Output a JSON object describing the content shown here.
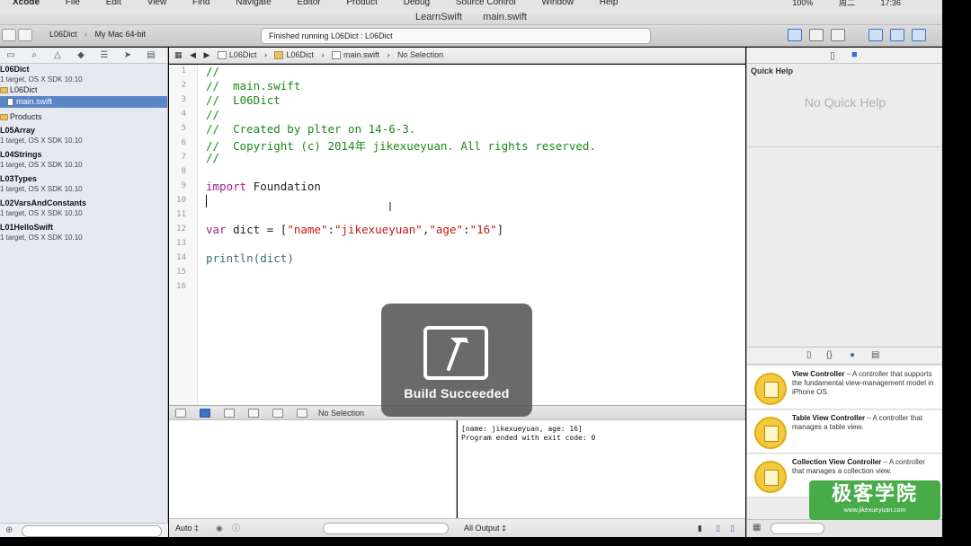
{
  "menubar": {
    "app": "Xcode",
    "items": [
      "File",
      "Edit",
      "View",
      "Find",
      "Navigate",
      "Editor",
      "Product",
      "Debug",
      "Source Control",
      "Window",
      "Help"
    ],
    "battery": "100%",
    "day": "周二",
    "clock": "17:36"
  },
  "titlebar": {
    "project": "LearnSwift",
    "file": "main.swift"
  },
  "toolbar": {
    "scheme": "L06Dict",
    "destination": "My Mac 64-bit",
    "activity": "Finished running L06Dict : L06Dict"
  },
  "navigator": {
    "projects": [
      {
        "name": "L06Dict",
        "sub": "1 target, OS X SDK 10.10"
      },
      {
        "name": "L05Array",
        "sub": "1 target, OS X SDK 10.10"
      },
      {
        "name": "L04Strings",
        "sub": "1 target, OS X SDK 10.10"
      },
      {
        "name": "L03Types",
        "sub": "1 target, OS X SDK 10.10"
      },
      {
        "name": "L02VarsAndConstants",
        "sub": "1 target, OS X SDK 10.10"
      },
      {
        "name": "L01HelloSwift",
        "sub": "1 target, OS X SDK 10.10"
      }
    ],
    "group": "L06Dict",
    "selected_file": "main.swift",
    "products": "Products"
  },
  "jumpbar": {
    "project": "L06Dict",
    "group": "L06Dict",
    "file": "main.swift",
    "selection": "No Selection"
  },
  "editor": {
    "line_numbers": [
      "1",
      "2",
      "3",
      "4",
      "5",
      "6",
      "7",
      "8",
      "9",
      "10",
      "11",
      "12",
      "13",
      "14",
      "15",
      "16"
    ],
    "lines": {
      "l1": "//",
      "l2": "//  main.swift",
      "l3": "//  L06Dict",
      "l4": "//",
      "l5": "//  Created by plter on 14-6-3.",
      "l6": "//  Copyright (c) 2014年 jikexueyuan. All rights reserved.",
      "l7": "//",
      "l9_kw": "import",
      "l9_rest": " Foundation",
      "l12_kw": "var",
      "l12_a": " dict = [",
      "l12_s1": "\"name\"",
      "l12_b": ":",
      "l12_s2": "\"jikexueyuan\"",
      "l12_c": ",",
      "l12_s3": "\"age\"",
      "l12_d": ":",
      "l12_s4": "\"16\"",
      "l12_e": "]",
      "l14_fn": "println",
      "l14_rest": "(dict)"
    }
  },
  "debug": {
    "selection": "No Selection"
  },
  "console": {
    "line1": "[name: jikexueyuan, age: 16]",
    "line2": "Program ended with exit code: 0"
  },
  "bottombar": {
    "auto": "Auto ‡",
    "all_output": "All Output ‡"
  },
  "inspector": {
    "quick_help_title": "Quick Help",
    "quick_help_empty": "No Quick Help",
    "library": [
      {
        "title": "View Controller",
        "desc": " – A controller that supports the fundamental view-management model in iPhone OS."
      },
      {
        "title": "Table View Controller",
        "desc": " – A controller that manages a table view."
      },
      {
        "title": "Collection View Controller",
        "desc": " – A controller that manages a collection view."
      }
    ]
  },
  "hud": {
    "label": "Build Succeeded"
  },
  "watermark": {
    "big": "极客学院",
    "small": "www.jikexueyuan.com"
  },
  "colors": {
    "comment": "#1a8a1a",
    "keyword": "#a0208d",
    "string": "#c41a16",
    "selection": "#5b86c6",
    "hud": "#555555"
  }
}
